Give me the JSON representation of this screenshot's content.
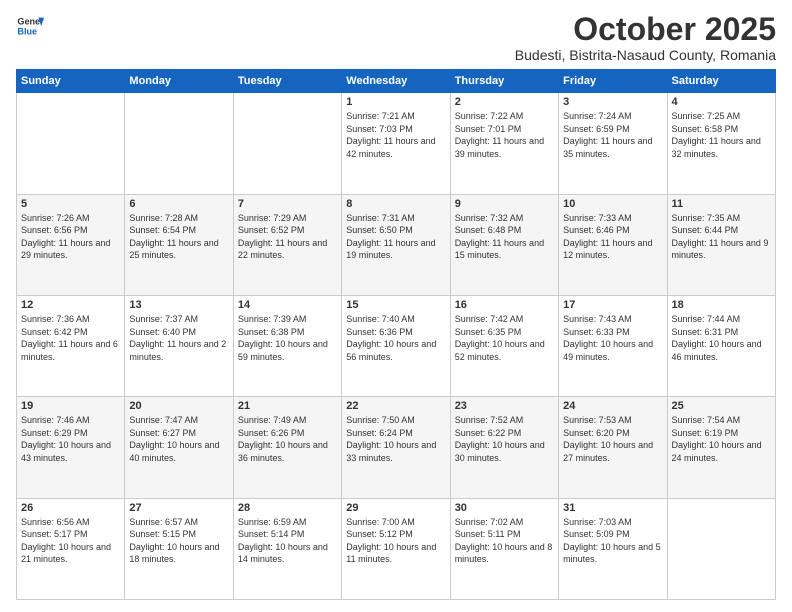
{
  "header": {
    "logo_general": "General",
    "logo_blue": "Blue",
    "month": "October 2025",
    "location": "Budesti, Bistrita-Nasaud County, Romania"
  },
  "days_of_week": [
    "Sunday",
    "Monday",
    "Tuesday",
    "Wednesday",
    "Thursday",
    "Friday",
    "Saturday"
  ],
  "weeks": [
    [
      {
        "day": "",
        "info": ""
      },
      {
        "day": "",
        "info": ""
      },
      {
        "day": "",
        "info": ""
      },
      {
        "day": "1",
        "info": "Sunrise: 7:21 AM\nSunset: 7:03 PM\nDaylight: 11 hours and 42 minutes."
      },
      {
        "day": "2",
        "info": "Sunrise: 7:22 AM\nSunset: 7:01 PM\nDaylight: 11 hours and 39 minutes."
      },
      {
        "day": "3",
        "info": "Sunrise: 7:24 AM\nSunset: 6:59 PM\nDaylight: 11 hours and 35 minutes."
      },
      {
        "day": "4",
        "info": "Sunrise: 7:25 AM\nSunset: 6:58 PM\nDaylight: 11 hours and 32 minutes."
      }
    ],
    [
      {
        "day": "5",
        "info": "Sunrise: 7:26 AM\nSunset: 6:56 PM\nDaylight: 11 hours and 29 minutes."
      },
      {
        "day": "6",
        "info": "Sunrise: 7:28 AM\nSunset: 6:54 PM\nDaylight: 11 hours and 25 minutes."
      },
      {
        "day": "7",
        "info": "Sunrise: 7:29 AM\nSunset: 6:52 PM\nDaylight: 11 hours and 22 minutes."
      },
      {
        "day": "8",
        "info": "Sunrise: 7:31 AM\nSunset: 6:50 PM\nDaylight: 11 hours and 19 minutes."
      },
      {
        "day": "9",
        "info": "Sunrise: 7:32 AM\nSunset: 6:48 PM\nDaylight: 11 hours and 15 minutes."
      },
      {
        "day": "10",
        "info": "Sunrise: 7:33 AM\nSunset: 6:46 PM\nDaylight: 11 hours and 12 minutes."
      },
      {
        "day": "11",
        "info": "Sunrise: 7:35 AM\nSunset: 6:44 PM\nDaylight: 11 hours and 9 minutes."
      }
    ],
    [
      {
        "day": "12",
        "info": "Sunrise: 7:36 AM\nSunset: 6:42 PM\nDaylight: 11 hours and 6 minutes."
      },
      {
        "day": "13",
        "info": "Sunrise: 7:37 AM\nSunset: 6:40 PM\nDaylight: 11 hours and 2 minutes."
      },
      {
        "day": "14",
        "info": "Sunrise: 7:39 AM\nSunset: 6:38 PM\nDaylight: 10 hours and 59 minutes."
      },
      {
        "day": "15",
        "info": "Sunrise: 7:40 AM\nSunset: 6:36 PM\nDaylight: 10 hours and 56 minutes."
      },
      {
        "day": "16",
        "info": "Sunrise: 7:42 AM\nSunset: 6:35 PM\nDaylight: 10 hours and 52 minutes."
      },
      {
        "day": "17",
        "info": "Sunrise: 7:43 AM\nSunset: 6:33 PM\nDaylight: 10 hours and 49 minutes."
      },
      {
        "day": "18",
        "info": "Sunrise: 7:44 AM\nSunset: 6:31 PM\nDaylight: 10 hours and 46 minutes."
      }
    ],
    [
      {
        "day": "19",
        "info": "Sunrise: 7:46 AM\nSunset: 6:29 PM\nDaylight: 10 hours and 43 minutes."
      },
      {
        "day": "20",
        "info": "Sunrise: 7:47 AM\nSunset: 6:27 PM\nDaylight: 10 hours and 40 minutes."
      },
      {
        "day": "21",
        "info": "Sunrise: 7:49 AM\nSunset: 6:26 PM\nDaylight: 10 hours and 36 minutes."
      },
      {
        "day": "22",
        "info": "Sunrise: 7:50 AM\nSunset: 6:24 PM\nDaylight: 10 hours and 33 minutes."
      },
      {
        "day": "23",
        "info": "Sunrise: 7:52 AM\nSunset: 6:22 PM\nDaylight: 10 hours and 30 minutes."
      },
      {
        "day": "24",
        "info": "Sunrise: 7:53 AM\nSunset: 6:20 PM\nDaylight: 10 hours and 27 minutes."
      },
      {
        "day": "25",
        "info": "Sunrise: 7:54 AM\nSunset: 6:19 PM\nDaylight: 10 hours and 24 minutes."
      }
    ],
    [
      {
        "day": "26",
        "info": "Sunrise: 6:56 AM\nSunset: 5:17 PM\nDaylight: 10 hours and 21 minutes."
      },
      {
        "day": "27",
        "info": "Sunrise: 6:57 AM\nSunset: 5:15 PM\nDaylight: 10 hours and 18 minutes."
      },
      {
        "day": "28",
        "info": "Sunrise: 6:59 AM\nSunset: 5:14 PM\nDaylight: 10 hours and 14 minutes."
      },
      {
        "day": "29",
        "info": "Sunrise: 7:00 AM\nSunset: 5:12 PM\nDaylight: 10 hours and 11 minutes."
      },
      {
        "day": "30",
        "info": "Sunrise: 7:02 AM\nSunset: 5:11 PM\nDaylight: 10 hours and 8 minutes."
      },
      {
        "day": "31",
        "info": "Sunrise: 7:03 AM\nSunset: 5:09 PM\nDaylight: 10 hours and 5 minutes."
      },
      {
        "day": "",
        "info": ""
      }
    ]
  ]
}
